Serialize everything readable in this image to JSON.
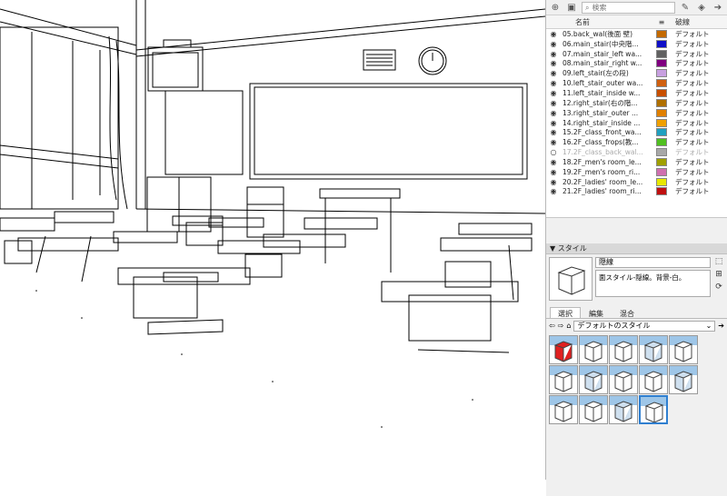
{
  "tray": {
    "search_placeholder": "検索",
    "col_name": "名前",
    "col_dash": "破線",
    "tags": [
      {
        "name": "05.back_wal(後面 壁)",
        "color": "#c46a00",
        "dash": "デフォルト",
        "visible": true
      },
      {
        "name": "06.main_stair(中央階...",
        "color": "#1010c8",
        "dash": "デフォルト",
        "visible": true
      },
      {
        "name": "07.main_stair_left wa...",
        "color": "#606060",
        "dash": "デフォルト",
        "visible": true
      },
      {
        "name": "08.main_stair_right w...",
        "color": "#800080",
        "dash": "デフォルト",
        "visible": true
      },
      {
        "name": "09.left_stair(左の段)",
        "color": "#c8a0e0",
        "dash": "デフォルト",
        "visible": true
      },
      {
        "name": "10.left_stair_outer wa...",
        "color": "#d06010",
        "dash": "デフォルト",
        "visible": true
      },
      {
        "name": "11.left_stair_inside w...",
        "color": "#c85000",
        "dash": "デフォルト",
        "visible": true
      },
      {
        "name": "12.right_stair(右の階...",
        "color": "#b07000",
        "dash": "デフォルト",
        "visible": true
      },
      {
        "name": "13.right_stair_outer ...",
        "color": "#e08000",
        "dash": "デフォルト",
        "visible": true
      },
      {
        "name": "14.right_stair_inside ...",
        "color": "#f0a000",
        "dash": "デフォルト",
        "visible": true
      },
      {
        "name": "15.2F_class_front_wa...",
        "color": "#20a0c0",
        "dash": "デフォルト",
        "visible": true
      },
      {
        "name": "16.2F_class_frops(教...",
        "color": "#50c020",
        "dash": "デフォルト",
        "visible": true
      },
      {
        "name": "17.2F_class_back_wal...",
        "color": "#a8a8a8",
        "dash": "デフォルト",
        "visible": false
      },
      {
        "name": "18.2F_men's room_le...",
        "color": "#a0a000",
        "dash": "デフォルト",
        "visible": true
      },
      {
        "name": "19.2F_men's room_ri...",
        "color": "#d070b0",
        "dash": "デフォルト",
        "visible": true
      },
      {
        "name": "20.2F_ladies' room_le...",
        "color": "#e8e800",
        "dash": "デフォルト",
        "visible": true
      },
      {
        "name": "21.2F_ladies' room_ri...",
        "color": "#c01010",
        "dash": "デフォルト",
        "visible": true
      }
    ],
    "styles_title": "スタイル",
    "style_name": "隠線",
    "style_desc": "面スタイル-隠線。背景-白。",
    "tabs": [
      "選択",
      "編集",
      "混合"
    ],
    "collection": "デフォルトのスタイル"
  }
}
